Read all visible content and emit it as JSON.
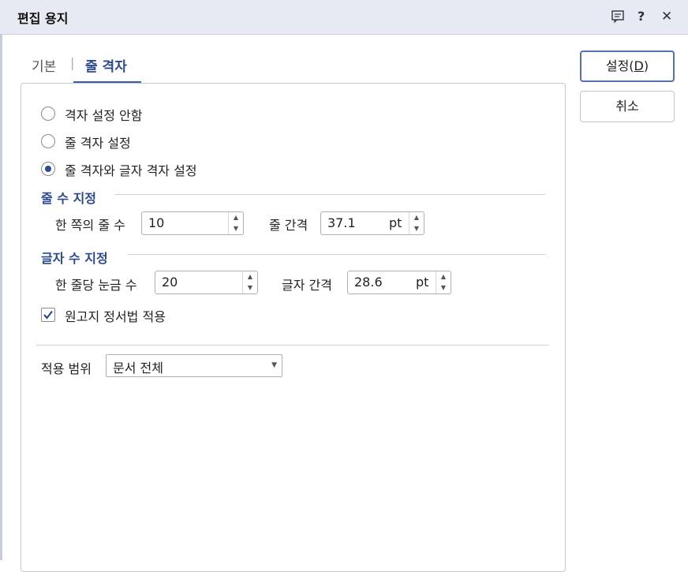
{
  "window": {
    "title": "편집 용지",
    "icons": [
      "memo-icon",
      "help-icon",
      "close-icon"
    ],
    "help_glyph": "?",
    "close_glyph": "✕"
  },
  "tabs": [
    {
      "label": "기본",
      "active": false
    },
    {
      "label": "줄 격자",
      "active": true
    }
  ],
  "tab_separator": "|",
  "grid_options": [
    {
      "label": "격자 설정 안함",
      "selected": false
    },
    {
      "label": "줄 격자 설정",
      "selected": false
    },
    {
      "label": "줄 격자와 글자 격자 설정",
      "selected": true
    }
  ],
  "line_count": {
    "section_title": "줄 수 지정",
    "per_page_label": "한 쪽의 줄 수",
    "per_page_value": "10",
    "spacing_label": "줄 간격",
    "spacing_value": "37.1",
    "spacing_unit": "pt"
  },
  "char_count": {
    "section_title": "글자 수 지정",
    "per_line_label": "한 줄당 눈금 수",
    "per_line_value": "20",
    "spacing_label": "글자 간격",
    "spacing_value": "28.6",
    "spacing_unit": "pt"
  },
  "manuscript": {
    "label": "원고지 정서법 적용",
    "checked": true
  },
  "scope": {
    "label": "적용 범위",
    "value": "문서 전체"
  },
  "buttons": {
    "ok_label": "설정(",
    "ok_mnemonic": "D",
    "ok_suffix": ")",
    "cancel_label": "취소"
  },
  "colors": {
    "accent": "#2b4a8e",
    "titlebar": "#e8eaf3"
  }
}
